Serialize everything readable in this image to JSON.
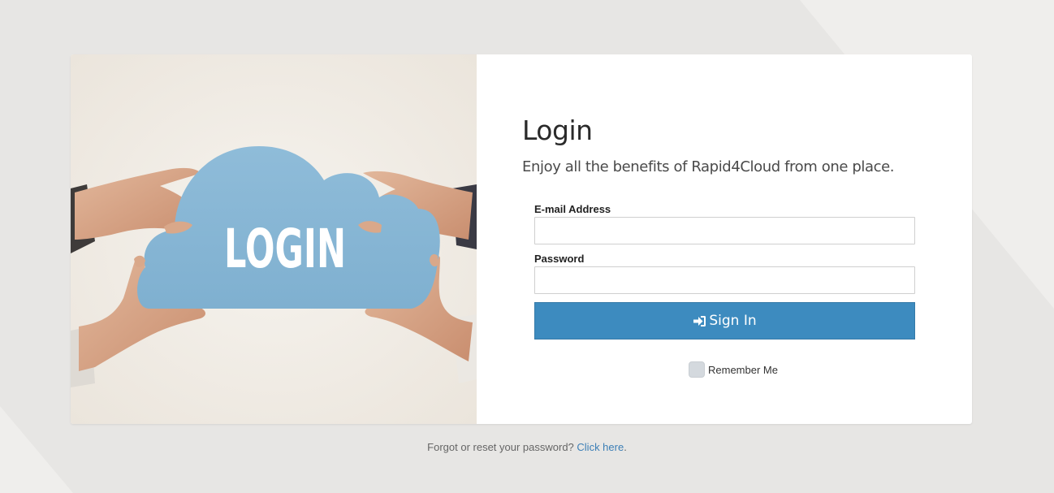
{
  "login": {
    "title": "Login",
    "subtitle": "Enjoy all the benefits of Rapid4Cloud from one place.",
    "hero_image_text": "LOGIN",
    "email": {
      "label": "E-mail Address",
      "value": "",
      "placeholder": ""
    },
    "password": {
      "label": "Password",
      "value": "",
      "placeholder": ""
    },
    "sign_in_button": {
      "label": "Sign In",
      "icon": "sign-in-icon"
    },
    "remember_me": {
      "label": "Remember Me",
      "checked": false
    }
  },
  "footer": {
    "prefix": "Forgot or reset your password?",
    "link_label": "Click here",
    "suffix": "."
  },
  "colors": {
    "page_background": "#e7e6e4",
    "primary_button": "#3d8bbf",
    "link": "#3d7fb6",
    "cloud": "#8ab8d6"
  }
}
